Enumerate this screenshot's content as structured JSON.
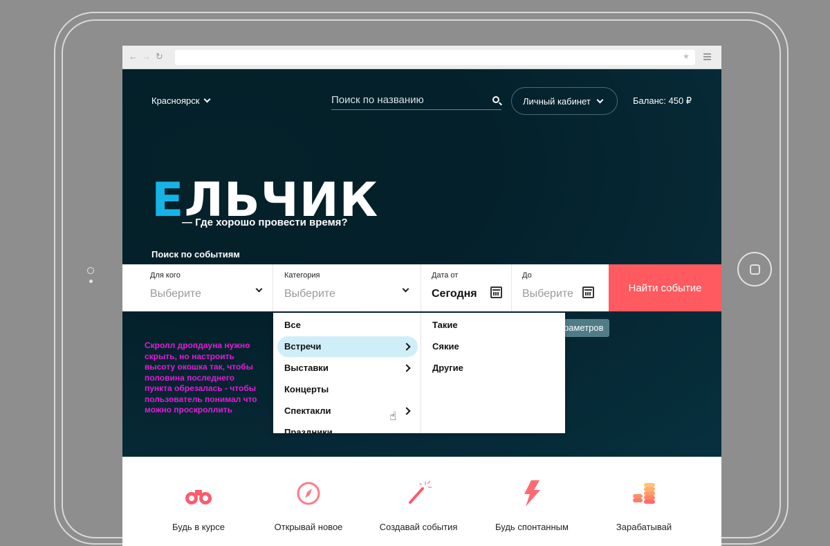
{
  "header": {
    "city": "Красноярск",
    "search_placeholder": "Поиск по названию",
    "cabinet": "Личный кабинет",
    "balance": "Баланс: 450 ₽"
  },
  "hero": {
    "logo_first": "Е",
    "logo_rest": "ЛЬЧИК",
    "tagline": "— Где хорошо провести время?",
    "search_title": "Поиск по событиям"
  },
  "filters": {
    "for_whom_label": "Для кого",
    "for_whom_value": "Выберите",
    "category_label": "Категория",
    "category_value": "Выберите",
    "date_from_label": "Дата от",
    "date_from_value": "Сегодня",
    "date_to_label": "До",
    "date_to_value": "Выберите",
    "find_button": "Найти событие",
    "params_chip": "раметров"
  },
  "dropdown": {
    "categories": [
      "Все",
      "Встречи",
      "Выставки",
      "Концерты",
      "Спектакли",
      "Праздники"
    ],
    "subcategories": [
      "Такие",
      "Сякие",
      "Другие"
    ]
  },
  "annotation": "Скролл дропдауна нужно скрыть, но настроить высоту окошка так, чтобы половина последнего пункта обрезалась - чтобы пользователь понимал что можно проскроллить",
  "features": [
    {
      "label": "Будь в курсе",
      "icon": "binoculars-icon"
    },
    {
      "label": "Открывай новое",
      "icon": "compass-icon"
    },
    {
      "label": "Создавай события",
      "icon": "magic-wand-icon"
    },
    {
      "label": "Будь спонтанным",
      "icon": "lightning-icon"
    },
    {
      "label": "Зарабатывай",
      "icon": "coins-icon"
    }
  ],
  "colors": {
    "accent": "#ff5a5f",
    "logo_blue": "#16b4e6",
    "hero_bg": "#04202a",
    "annotation": "#e41bd8",
    "feature_icon": "#ff5a6e"
  }
}
